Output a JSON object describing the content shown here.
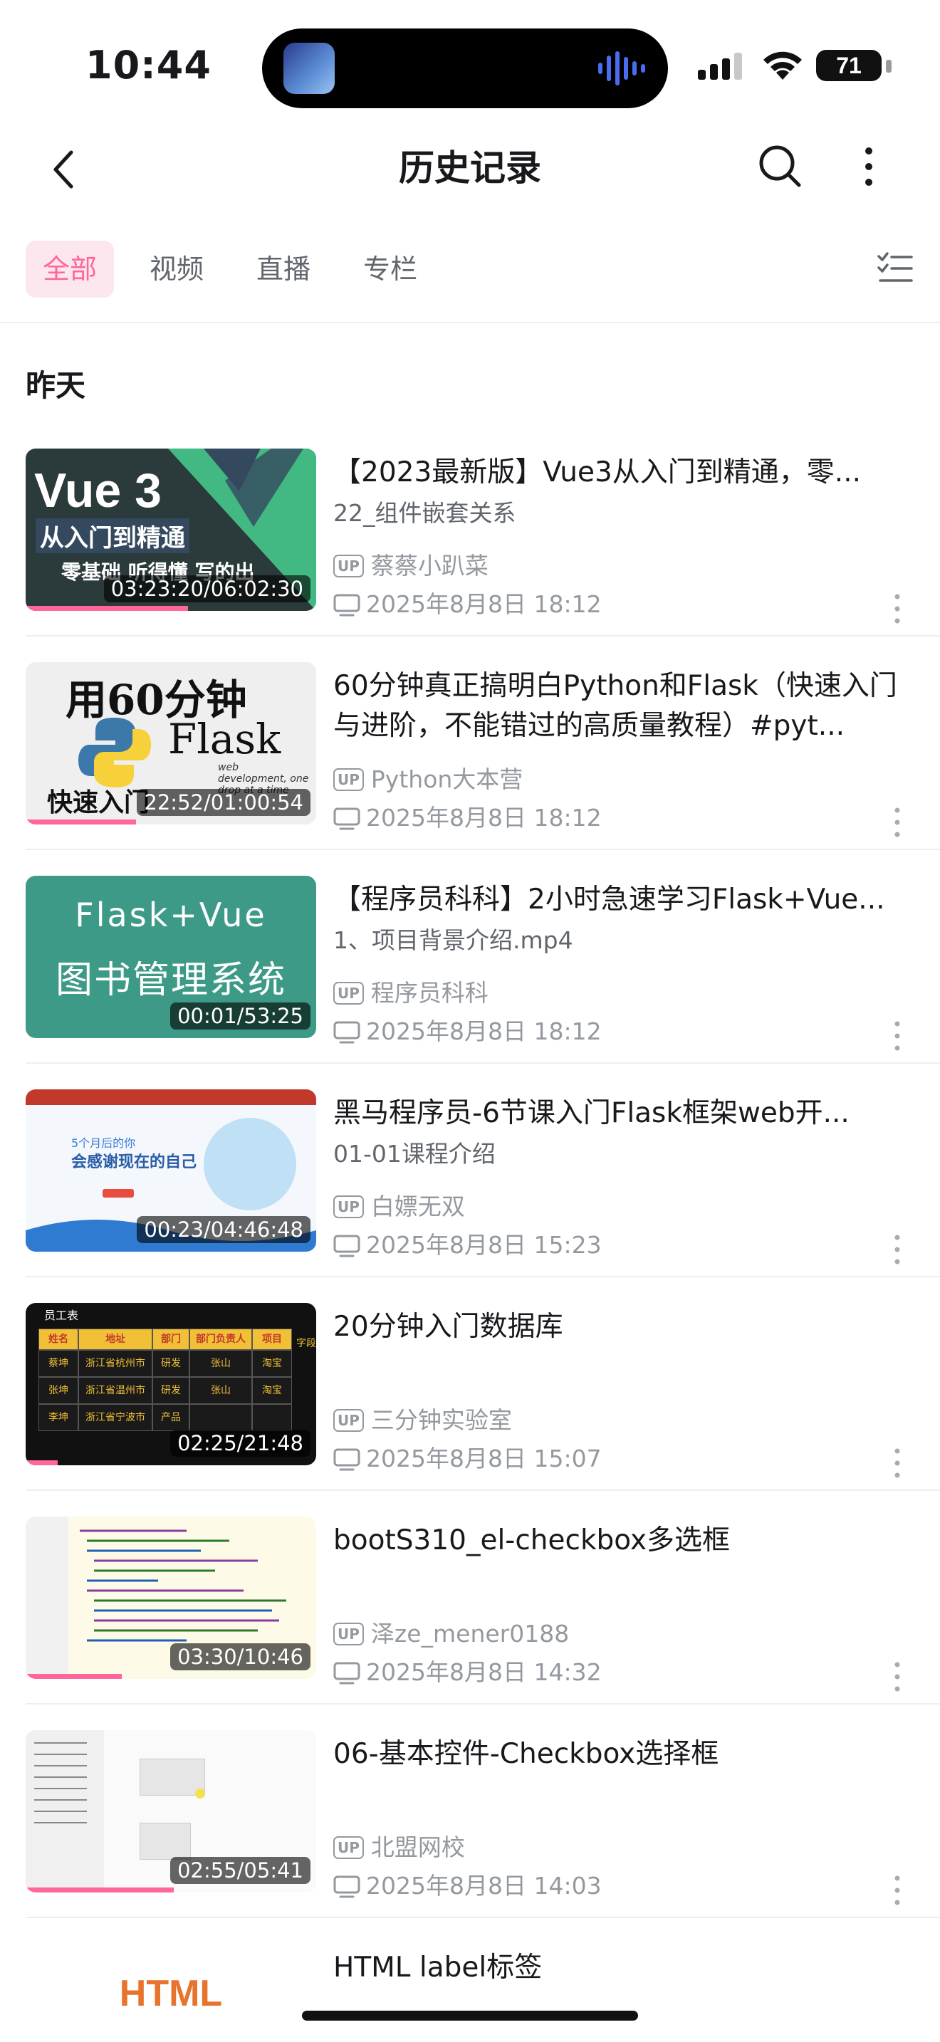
{
  "status": {
    "time": "10:44",
    "battery": "71"
  },
  "nav": {
    "title": "历史记录"
  },
  "tabs": [
    "全部",
    "视频",
    "直播",
    "专栏"
  ],
  "section": "昨天",
  "thumb_text": {
    "vue_big": "Vue 3",
    "vue_sub": "从入门到精通",
    "vue_small": "零基础 听得懂 写的出",
    "flask_a": "用60分钟",
    "flask_b": "Flask",
    "flask_c": "web development, one drop at a time",
    "flask_d": "快速入门",
    "green_a": "Flask+Vue",
    "green_b": "图书管理系统",
    "heima_a": "5个月后的你",
    "heima_b": "会感谢现在的自己",
    "tbl_title": "员工表",
    "tbl_headers": [
      "姓名",
      "地址",
      "部门",
      "部门负责人",
      "项目"
    ],
    "tbl_side": "字段",
    "tbl_rows": [
      [
        "蔡坤",
        "浙江省杭州市",
        "研发",
        "张山",
        "淘宝"
      ],
      [
        "张坤",
        "浙江省温州市",
        "研发",
        "张山",
        "淘宝"
      ],
      [
        "李坤",
        "浙江省宁波市",
        "产品",
        "",
        ""
      ]
    ],
    "html": "HTML"
  },
  "items": [
    {
      "title": "【2023最新版】Vue3从入门到精通，零...",
      "subtitle": "22_组件嵌套关系",
      "uploader": "蔡蔡小趴菜",
      "datetime": "2025年8月8日 18:12",
      "duration": "03:23:20/06:02:30",
      "progress": 0.56
    },
    {
      "title": "60分钟真正搞明白Python和Flask（快速入门与进阶，不能错过的高质量教程）#pyt...",
      "subtitle": "",
      "uploader": "Python大本营",
      "datetime": "2025年8月8日 18:12",
      "duration": "22:52/01:00:54",
      "progress": 0.38
    },
    {
      "title": "【程序员科科】2小时急速学习Flask+Vue...",
      "subtitle": "1、项目背景介绍.mp4",
      "uploader": "程序员科科",
      "datetime": "2025年8月8日 18:12",
      "duration": "00:01/53:25",
      "progress": 0.01
    },
    {
      "title": "黑马程序员-6节课入门Flask框架web开...",
      "subtitle": "01-01课程介绍",
      "uploader": "白嫖无双",
      "datetime": "2025年8月8日 15:23",
      "duration": "00:23/04:46:48",
      "progress": 0.01
    },
    {
      "title": "20分钟入门数据库",
      "subtitle": "",
      "uploader": "三分钟实验室",
      "datetime": "2025年8月8日 15:07",
      "duration": "02:25/21:48",
      "progress": 0.11
    },
    {
      "title": "bootS310_el-checkbox多选框",
      "subtitle": "",
      "uploader": "泽ze_mener0188",
      "datetime": "2025年8月8日 14:32",
      "duration": "03:30/10:46",
      "progress": 0.33
    },
    {
      "title": "06-基本控件-Checkbox选择框",
      "subtitle": "",
      "uploader": "北盟网校",
      "datetime": "2025年8月8日 14:03",
      "duration": "02:55/05:41",
      "progress": 0.51
    },
    {
      "title": "HTML label标签",
      "subtitle": "",
      "uploader": "",
      "datetime": "",
      "duration": "",
      "progress": 0
    }
  ],
  "icons": {
    "back": "chevron-left-icon",
    "search": "search-icon",
    "more": "more-vertical-icon",
    "list": "list-check-icon",
    "up": "up-badge-icon",
    "tv": "tv-icon"
  },
  "colors": {
    "accent": "#ff6699",
    "tab_bg": "#fde7ee",
    "meta": "#9499a0"
  }
}
